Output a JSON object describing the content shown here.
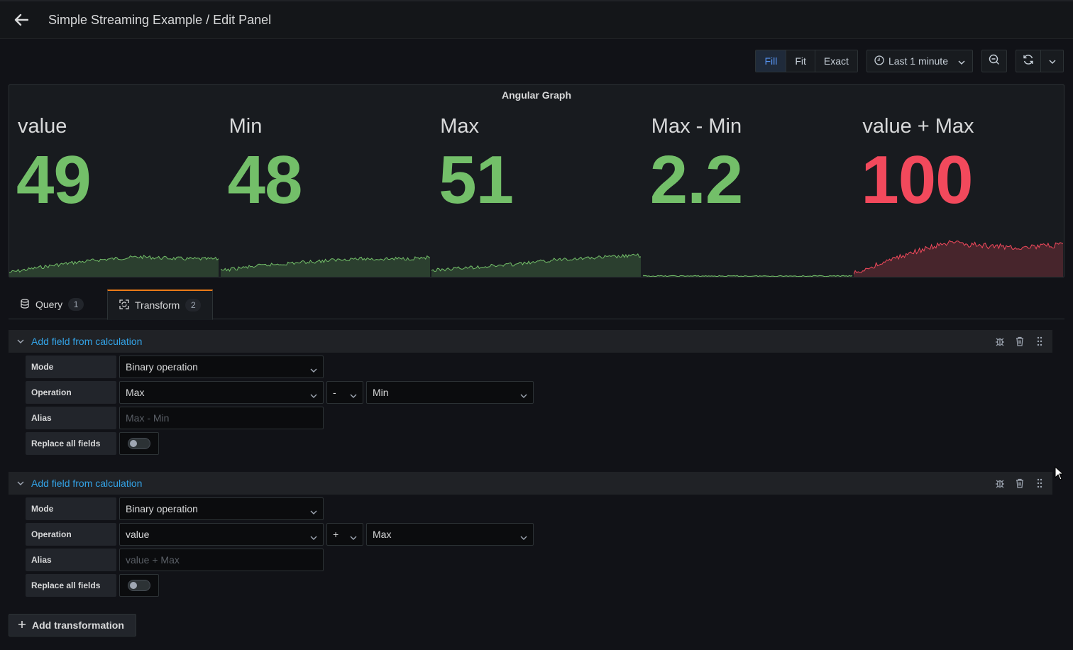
{
  "header": {
    "title": "Simple Streaming Example / Edit Panel"
  },
  "toolbar": {
    "fill_label": "Fill",
    "fit_label": "Fit",
    "exact_label": "Exact",
    "time_range": "Last 1 minute"
  },
  "colors": {
    "green": "#73bf69",
    "red": "#f2495c",
    "accent": "#eb7b18",
    "link": "#33a2e5"
  },
  "panel": {
    "title": "Angular Graph",
    "stats": [
      {
        "name": "value",
        "value": "49",
        "color": "#73bf69",
        "trend": "rising"
      },
      {
        "name": "Min",
        "value": "48",
        "color": "#73bf69",
        "trend": "rising"
      },
      {
        "name": "Max",
        "value": "51",
        "color": "#73bf69",
        "trend": "rising"
      },
      {
        "name": "Max - Min",
        "value": "2.2",
        "color": "#73bf69",
        "trend": "flat"
      },
      {
        "name": "value + Max",
        "value": "100",
        "color": "#f2495c",
        "trend": "rising"
      }
    ]
  },
  "tabs": [
    {
      "label": "Query",
      "count": "1"
    },
    {
      "label": "Transform",
      "count": "2"
    }
  ],
  "transformations": [
    {
      "title": "Add field from calculation",
      "mode_label": "Mode",
      "mode_value": "Binary operation",
      "operation_label": "Operation",
      "left": "Max",
      "operator": "-",
      "right": "Min",
      "alias_label": "Alias",
      "alias_placeholder": "Max - Min",
      "replace_label": "Replace all fields"
    },
    {
      "title": "Add field from calculation",
      "mode_label": "Mode",
      "mode_value": "Binary operation",
      "operation_label": "Operation",
      "left": "value",
      "operator": "+",
      "right": "Max",
      "alias_label": "Alias",
      "alias_placeholder": "value + Max",
      "replace_label": "Replace all fields"
    }
  ],
  "add_transformation_label": "Add transformation"
}
